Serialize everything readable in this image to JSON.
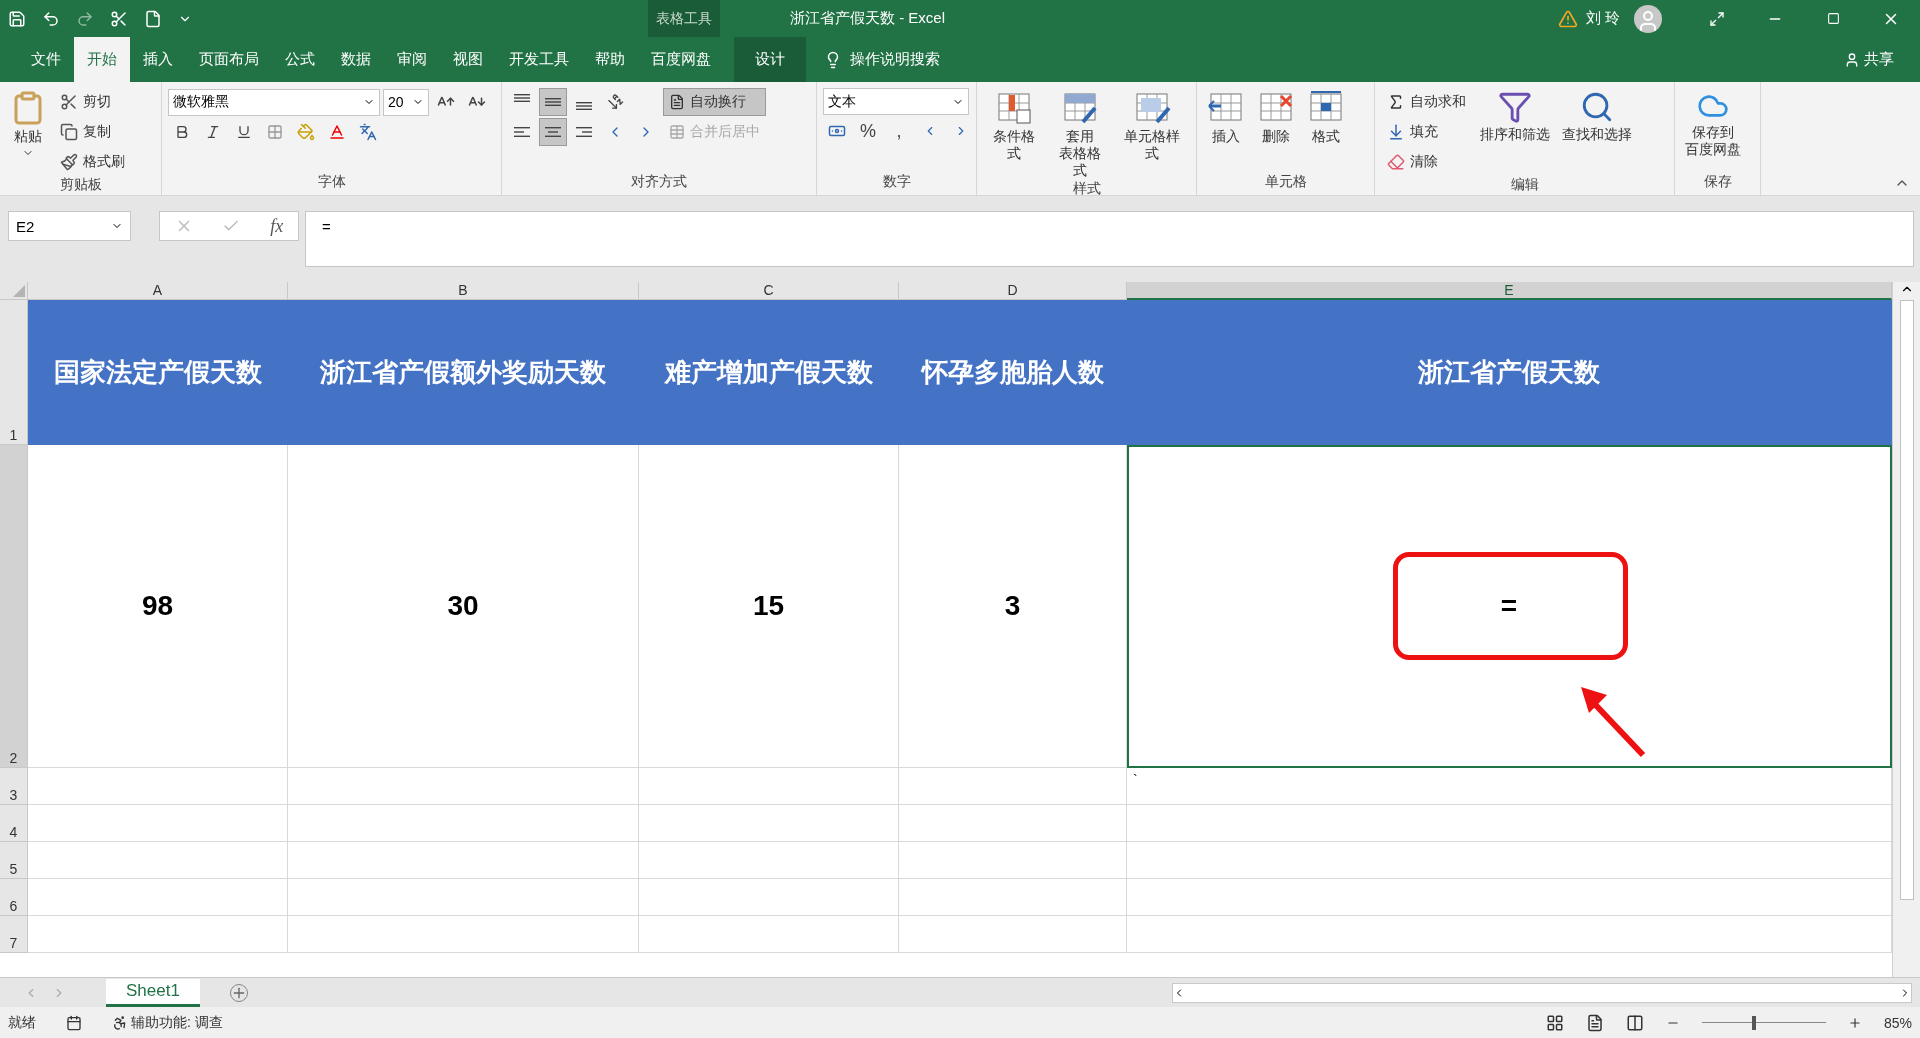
{
  "title_bar": {
    "context_label": "表格工具",
    "title": "浙江省产假天数  -  Excel",
    "user": "刘 玲"
  },
  "menu_tabs": [
    {
      "label": "文件",
      "selected": false
    },
    {
      "label": "开始",
      "selected": true
    },
    {
      "label": "插入",
      "selected": false
    },
    {
      "label": "页面布局",
      "selected": false
    },
    {
      "label": "公式",
      "selected": false
    },
    {
      "label": "数据",
      "selected": false
    },
    {
      "label": "审阅",
      "selected": false
    },
    {
      "label": "视图",
      "selected": false
    },
    {
      "label": "开发工具",
      "selected": false
    },
    {
      "label": "帮助",
      "selected": false
    },
    {
      "label": "百度网盘",
      "selected": false
    }
  ],
  "context_tab": {
    "label": "设计"
  },
  "tell_me": {
    "placeholder": "操作说明搜索"
  },
  "share": "共享",
  "ribbon": {
    "groups": [
      {
        "kind": "clipboard",
        "label": "剪贴板",
        "paste": "粘贴",
        "items": [
          "剪切",
          "复制",
          "格式刷"
        ]
      },
      {
        "kind": "font",
        "label": "字体",
        "font_name": "微软雅黑",
        "font_size": "20"
      },
      {
        "kind": "alignment",
        "label": "对齐方式",
        "vertical_align": [
          {
            "selected": false
          },
          {
            "selected": true
          },
          {
            "selected": false
          }
        ],
        "horizontal_align": [
          {
            "selected": false
          },
          {
            "selected": true
          },
          {
            "selected": false
          }
        ],
        "wrap": {
          "label": "自动换行",
          "on": true
        },
        "merge": {
          "label": "合并后居中",
          "disabled": true
        }
      },
      {
        "kind": "number",
        "label": "数字",
        "format": "文本",
        "percent": "%",
        "comma": ","
      },
      {
        "kind": "styles",
        "label": "样式",
        "buttons": [
          {
            "lines": [
              "条件格式"
            ]
          },
          {
            "lines": [
              "套用",
              "表格格式"
            ]
          },
          {
            "lines": [
              "单元格样式"
            ]
          }
        ]
      },
      {
        "kind": "cells",
        "label": "单元格",
        "buttons": [
          "插入",
          "删除",
          "格式"
        ]
      },
      {
        "kind": "editing",
        "label": "编辑",
        "small": [
          "自动求和",
          "填充",
          "清除"
        ],
        "buttons": [
          "排序和筛选",
          "查找和选择"
        ]
      },
      {
        "kind": "save",
        "label": "保存",
        "buttons": [
          {
            "lines": [
              "保存到",
              "百度网盘"
            ]
          }
        ]
      }
    ]
  },
  "formula_bar": {
    "name_box": "E2",
    "fx_label": "fx",
    "formula": "="
  },
  "sheet": {
    "columns": [
      {
        "label": "A",
        "selected": false
      },
      {
        "label": "B",
        "selected": false
      },
      {
        "label": "C",
        "selected": false
      },
      {
        "label": "D",
        "selected": false
      },
      {
        "label": "E",
        "selected": true
      }
    ],
    "rows": [
      {
        "number": "1",
        "kind": "header",
        "selected": false,
        "cells": [
          {
            "text": "国家法定产假天数"
          },
          {
            "text": "浙江省产假额外奖励天数"
          },
          {
            "text": "难产增加产假天数"
          },
          {
            "text": "怀孕多胞胎人数"
          },
          {
            "text": "浙江省产假天数"
          }
        ]
      },
      {
        "number": "2",
        "kind": "data",
        "selected": true,
        "cells": [
          {
            "text": "98",
            "annotated": false
          },
          {
            "text": "30",
            "annotated": false
          },
          {
            "text": "15",
            "annotated": false
          },
          {
            "text": "3",
            "annotated": false
          },
          {
            "text": "=",
            "annotated": true
          }
        ]
      },
      {
        "number": "3",
        "kind": "plain",
        "selected": false,
        "last_cell": "`"
      },
      {
        "number": "4",
        "kind": "plain",
        "selected": false
      },
      {
        "number": "5",
        "kind": "plain",
        "selected": false
      },
      {
        "number": "6",
        "kind": "plain",
        "selected": false
      },
      {
        "number": "7",
        "kind": "plain",
        "selected": false
      }
    ]
  },
  "sheet_tabs": [
    {
      "label": "Sheet1",
      "selected": true
    }
  ],
  "status_bar": {
    "ready": "就绪",
    "accessibility": "辅助功能: 调查",
    "zoom": "85%",
    "zoom_slider": {
      "level": 0.42
    }
  }
}
